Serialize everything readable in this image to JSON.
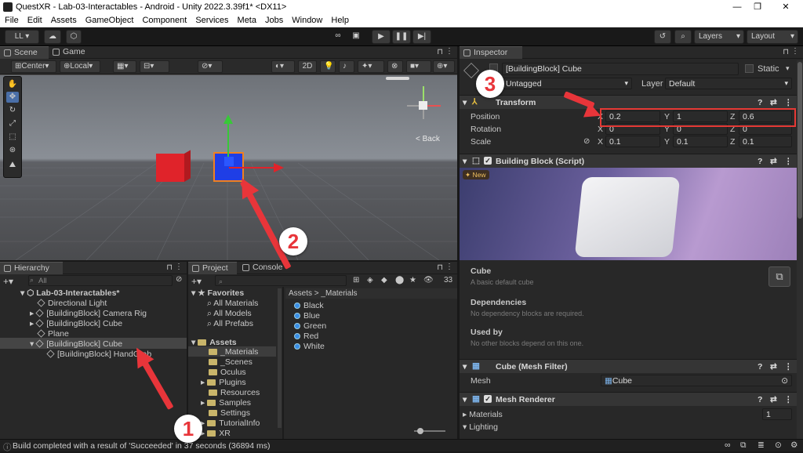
{
  "window": {
    "title": "QuestXR - Lab-03-Interactables - Android - Unity 2022.3.39f1* <DX11>"
  },
  "menu": [
    "File",
    "Edit",
    "Assets",
    "GameObject",
    "Component",
    "Services",
    "Meta",
    "Jobs",
    "Window",
    "Help"
  ],
  "toolbar": {
    "account": "LL",
    "layers": "Layers",
    "layout": "Layout"
  },
  "scene_tabs": {
    "scene": "Scene",
    "game": "Game"
  },
  "scene_toolbar": {
    "pivot": "Center",
    "space": "Local",
    "mode2d": "2D"
  },
  "gizmo": {
    "back_label": "< Back"
  },
  "hierarchy": {
    "tab": "Hierarchy",
    "search_placeholder": "All",
    "scene": "Lab-03-Interactables*",
    "items": [
      "Directional Light",
      "[BuildingBlock] Camera Rig",
      "[BuildingBlock] Cube",
      "Plane",
      "[BuildingBlock] Cube",
      "[BuildingBlock] HandGrab"
    ]
  },
  "project": {
    "tab_project": "Project",
    "tab_console": "Console",
    "count": "33",
    "favorites_label": "Favorites",
    "favorites": [
      "All Materials",
      "All Models",
      "All Prefabs"
    ],
    "assets_label": "Assets",
    "folders": [
      "_Materials",
      "_Scenes",
      "Oculus",
      "Plugins",
      "Resources",
      "Samples",
      "Settings",
      "TutorialInfo",
      "XR"
    ],
    "breadcrumb_root": "Assets",
    "breadcrumb_sep": ">",
    "breadcrumb_leaf": "_Materials",
    "materials": [
      "Black",
      "Blue",
      "Green",
      "Red",
      "White"
    ]
  },
  "inspector": {
    "tab": "Inspector",
    "object_name": "[BuildingBlock] Cube",
    "static_label": "Static",
    "tag": "Untagged",
    "layer_label": "Layer",
    "layer": "Default",
    "transform_label": "Transform",
    "position_label": "Position",
    "rotation_label": "Rotation",
    "scale_label": "Scale",
    "position": {
      "x": "0.2",
      "y": "1",
      "z": "0.6"
    },
    "rotation": {
      "x": "0",
      "y": "0",
      "z": "0"
    },
    "scale": {
      "x": "0.1",
      "y": "0.1",
      "z": "0.1"
    },
    "axis_x": "X",
    "axis_y": "Y",
    "axis_z": "Z",
    "building_block_label": "Building Block (Script)",
    "new_badge": "New",
    "block_name": "Cube",
    "block_desc": "A basic default cube",
    "dependencies_label": "Dependencies",
    "dependencies_desc": "No dependency blocks are required.",
    "used_by_label": "Used by",
    "used_by_desc": "No other blocks depend on this one.",
    "mesh_filter_label": "Cube (Mesh Filter)",
    "mesh_label": "Mesh",
    "mesh_value": "Cube",
    "mesh_renderer_label": "Mesh Renderer",
    "materials_label": "Materials",
    "materials_count": "1",
    "lighting_label": "Lighting"
  },
  "status": {
    "message": "Build completed with a result of 'Succeeded' in 37 seconds (36894 ms)"
  },
  "annotations": {
    "one": "1",
    "two": "2",
    "three": "3"
  },
  "colors": {
    "arrow": "#e8353a",
    "highlight": "#e53935",
    "cube_red": "#e0232a",
    "cube_blue": "#1f3ee6"
  }
}
